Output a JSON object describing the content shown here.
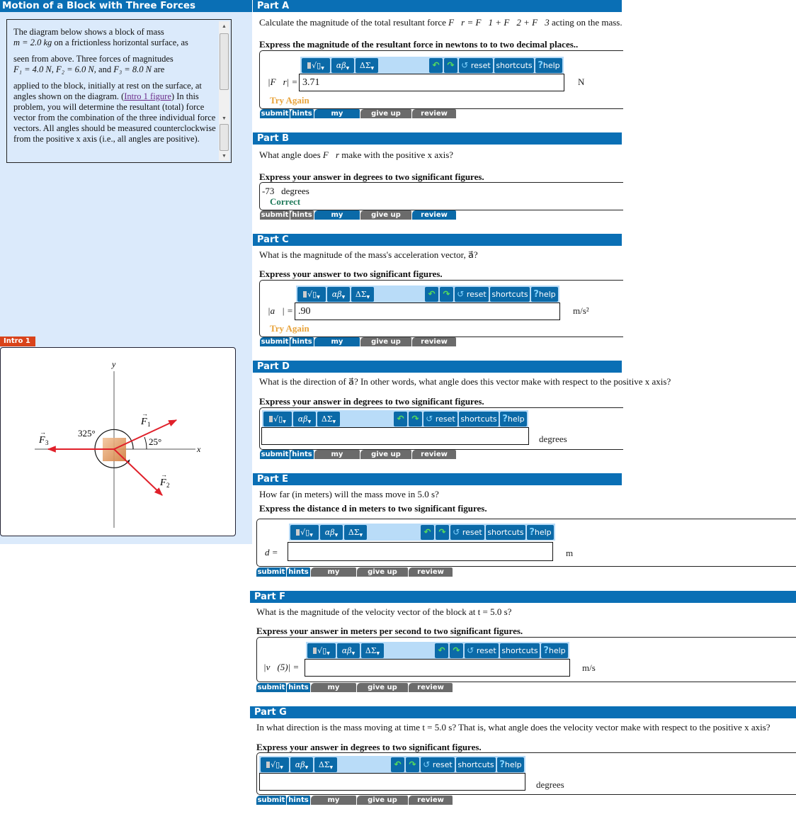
{
  "problem": {
    "title": "Motion of a Block with Three Forces",
    "intro_paragraphs": [
      "The diagram below shows a block of mass m = 2.0 kg on a frictionless horizontal surface, as",
      "seen from above. Three forces of magnitudes F1 = 4.0 N, F2 = 6.0 N, and F3 = 8.0 N are",
      "applied to the block, initially at rest on the surface, at angles shown on the diagram."
    ],
    "intro_line1": "The diagram below shows a block of mass",
    "intro_line2_math": "m = 2.0 kg",
    "intro_line2_rest": "on a frictionless horizontal surface, as",
    "intro_line3": "seen from above. Three forces of magnitudes",
    "intro_line4_math": "F₁ = 4.0 N, F₂ = 6.0 N,",
    "intro_line4_and": "and",
    "intro_line4_math2": "F₃ = 8.0 N",
    "intro_line4_rest": "are",
    "intro_line5": "applied to the block, initially at rest on the surface, at angles shown on the diagram.",
    "intro_link": "Intro 1 figure",
    "intro_line6": "In this problem, you will determine the resultant (total) force vector from the combination of the three individual force vectors. All angles should be measured counterclockwise from the positive x axis (i.e., all angles are positive).",
    "figure_tab": "Intro 1",
    "figure": {
      "axis_x": "x",
      "axis_y": "y",
      "f1_label": "F1",
      "f2_label": "F2",
      "f3_label": "F3",
      "angle1": "25°",
      "angle2": "325°",
      "force_color": "#e0202a",
      "block_color": "#d98a4a"
    }
  },
  "toolbar": {
    "templates": "√▯",
    "greek": "αβ",
    "symbols": "ΔΣ",
    "undo_icon": "undo-arrow",
    "redo_icon": "redo-arrow",
    "reset": "reset",
    "shortcuts": "shortcuts",
    "help": "help"
  },
  "buttons": {
    "submit": "submit",
    "hints": "hints",
    "my_answers": "my answers",
    "give_up": "give up",
    "review_part": "review part"
  },
  "parts": [
    {
      "header": "Part A",
      "question_pre": "Calculate the magnitude of the total resultant force",
      "question_math": "F⃗r = F⃗1 + F⃗2 + F⃗3",
      "question_post": "acting on the mass.",
      "instruction": "Express the magnitude of the resultant force in newtons to to two decimal places..",
      "label": "|F⃗r| =",
      "value": "3.71",
      "unit": "N",
      "status": "Try Again"
    },
    {
      "header": "Part B",
      "question_pre": "What angle does",
      "question_math": "F⃗r",
      "question_post": "make with the positive x axis?",
      "instruction": "Express your answer in degrees to two significant figures.",
      "value": "-73",
      "unit": "degrees",
      "status": "Correct"
    },
    {
      "header": "Part C",
      "question": "What is the magnitude of the mass's acceleration vector, a⃗?",
      "instruction": "Express your answer to two significant figures.",
      "label": "|a⃗| =",
      "value": ".90",
      "unit": "m/s²",
      "status": "Try Again"
    },
    {
      "header": "Part D",
      "question": "What is the direction of a⃗? In other words, what angle does this vector make with respect to the positive x axis?",
      "instruction": "Express your answer in degrees to two significant figures.",
      "value": "",
      "unit": "degrees"
    },
    {
      "header": "Part E",
      "question": "How far (in meters) will the mass move in 5.0 s?",
      "instruction": "Express the distance d in meters to two significant figures.",
      "label": "d =",
      "value": "",
      "unit": "m"
    },
    {
      "header": "Part F",
      "question": "What is the magnitude of the velocity vector of the block at t = 5.0 s?",
      "instruction": "Express your answer in meters per second to two significant figures.",
      "label": "|v⃗(5)| =",
      "value": "",
      "unit": "m/s"
    },
    {
      "header": "Part G",
      "question": "In what direction is the mass moving at time t = 5.0 s? That is, what angle does the velocity vector make with respect to the positive x axis?",
      "instruction": "Express your answer in degrees to two significant figures.",
      "value": "",
      "unit": "degrees"
    }
  ]
}
